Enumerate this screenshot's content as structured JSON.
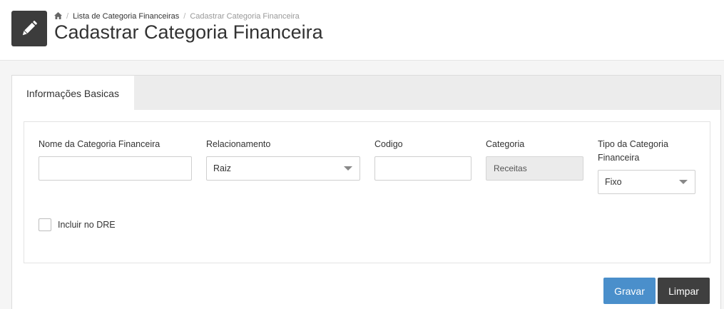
{
  "breadcrumb": {
    "items": [
      {
        "label": "Lista de Categoria Financeiras"
      },
      {
        "label": "Cadastrar Categoria Financeira"
      }
    ]
  },
  "page": {
    "title": "Cadastrar Categoria Financeira"
  },
  "tabs": [
    {
      "label": "Informações Basicas"
    }
  ],
  "form": {
    "nome": {
      "label": "Nome da Categoria Financeira",
      "value": ""
    },
    "relacionamento": {
      "label": "Relacionamento",
      "value": "Raiz"
    },
    "codigo": {
      "label": "Codigo",
      "value": ""
    },
    "categoria": {
      "label": "Categoria",
      "value": "Receitas"
    },
    "tipo": {
      "label_line1": "Tipo da Categoria",
      "label_line2": "Financeira",
      "value": "Fixo"
    },
    "incluir_dre": {
      "label": "Incluir no DRE"
    }
  },
  "actions": {
    "save_label": "Gravar",
    "clear_label": "Limpar"
  },
  "icons": {
    "page": "pencil-icon",
    "home": "home-icon"
  },
  "colors": {
    "primary": "#4a8fcb",
    "dark": "#3f3f3f",
    "icon_bg": "#3c3c3c"
  }
}
